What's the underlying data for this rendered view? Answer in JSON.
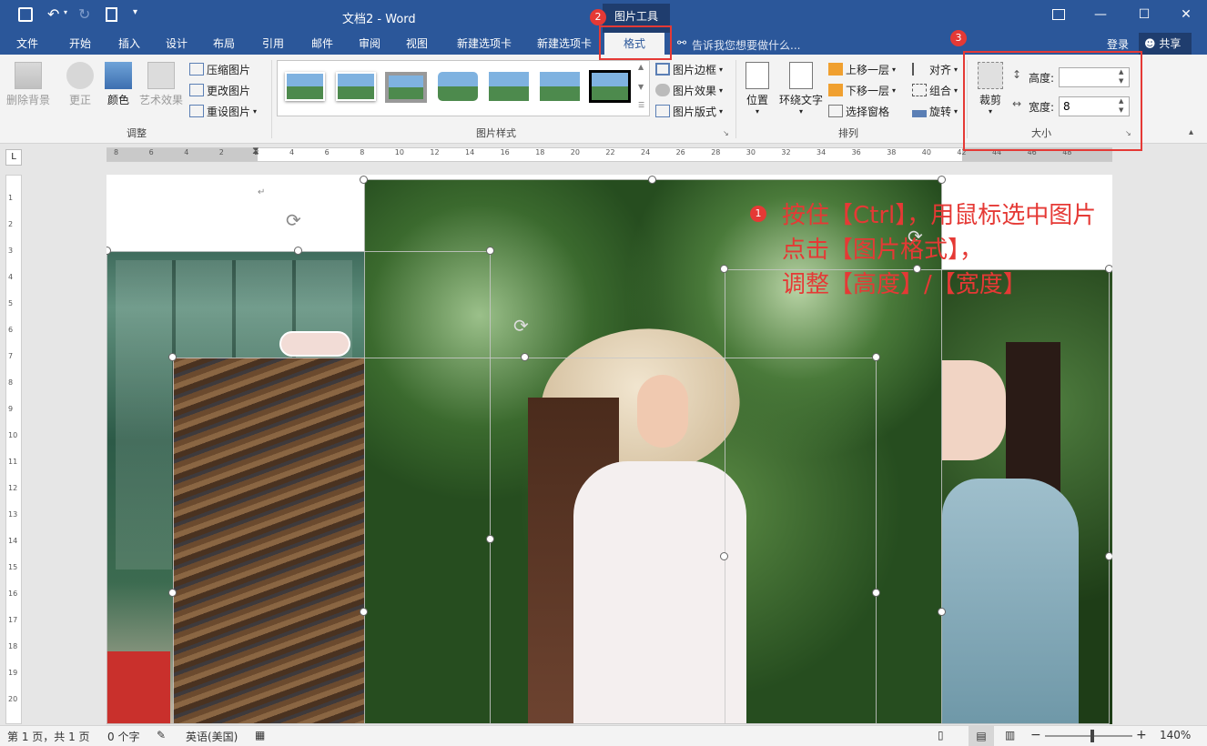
{
  "window": {
    "title": "文档2 - Word",
    "context_tab": "图片工具"
  },
  "tabs": [
    "文件",
    "开始",
    "插入",
    "设计",
    "布局",
    "引用",
    "邮件",
    "审阅",
    "视图",
    "新建选项卡",
    "新建选项卡",
    "格式"
  ],
  "tell_me": "告诉我您想要做什么...",
  "login": "登录",
  "share": "共享",
  "ribbon": {
    "adjust": {
      "remove_bg": "删除背景",
      "correct": "更正",
      "color": "颜色",
      "artistic": "艺术效果",
      "compress": "压缩图片",
      "change": "更改图片",
      "reset": "重设图片",
      "label": "调整"
    },
    "styles": {
      "border": "图片边框",
      "effects": "图片效果",
      "layout": "图片版式",
      "label": "图片样式"
    },
    "arrange": {
      "position": "位置",
      "wrap": "环绕文字",
      "bring_forward": "上移一层",
      "send_backward": "下移一层",
      "selection_pane": "选择窗格",
      "align": "对齐",
      "group": "组合",
      "rotate": "旋转",
      "label": "排列"
    },
    "size": {
      "crop": "裁剪",
      "height_label": "高度:",
      "height_value": "",
      "width_label": "宽度:",
      "width_value": "8",
      "label": "大小"
    }
  },
  "ruler": {
    "corner": "L",
    "h_ticks": [
      "8",
      "6",
      "4",
      "2",
      "2",
      "4",
      "6",
      "8",
      "10",
      "12",
      "14",
      "16",
      "18",
      "20",
      "22",
      "24",
      "26",
      "28",
      "30",
      "32",
      "34",
      "36",
      "38",
      "40",
      "42",
      "44",
      "46",
      "48"
    ],
    "v_ticks": [
      "1",
      "2",
      "3",
      "4",
      "5",
      "6",
      "7",
      "8",
      "9",
      "10",
      "11",
      "12",
      "13",
      "14",
      "15",
      "16",
      "17",
      "18",
      "19",
      "20"
    ]
  },
  "annotation": {
    "lines": [
      "按住【Ctrl】，用鼠标选中图片",
      "点击【图片格式】，",
      "调整【高度】/【宽度】"
    ],
    "badges": [
      "1",
      "2",
      "3"
    ]
  },
  "status": {
    "page": "第 1 页，共 1 页",
    "words": "0 个字",
    "language": "英语(美国)",
    "zoom": "140%"
  },
  "colors": {
    "word_blue": "#2b579a",
    "highlight_red": "#e53935"
  }
}
